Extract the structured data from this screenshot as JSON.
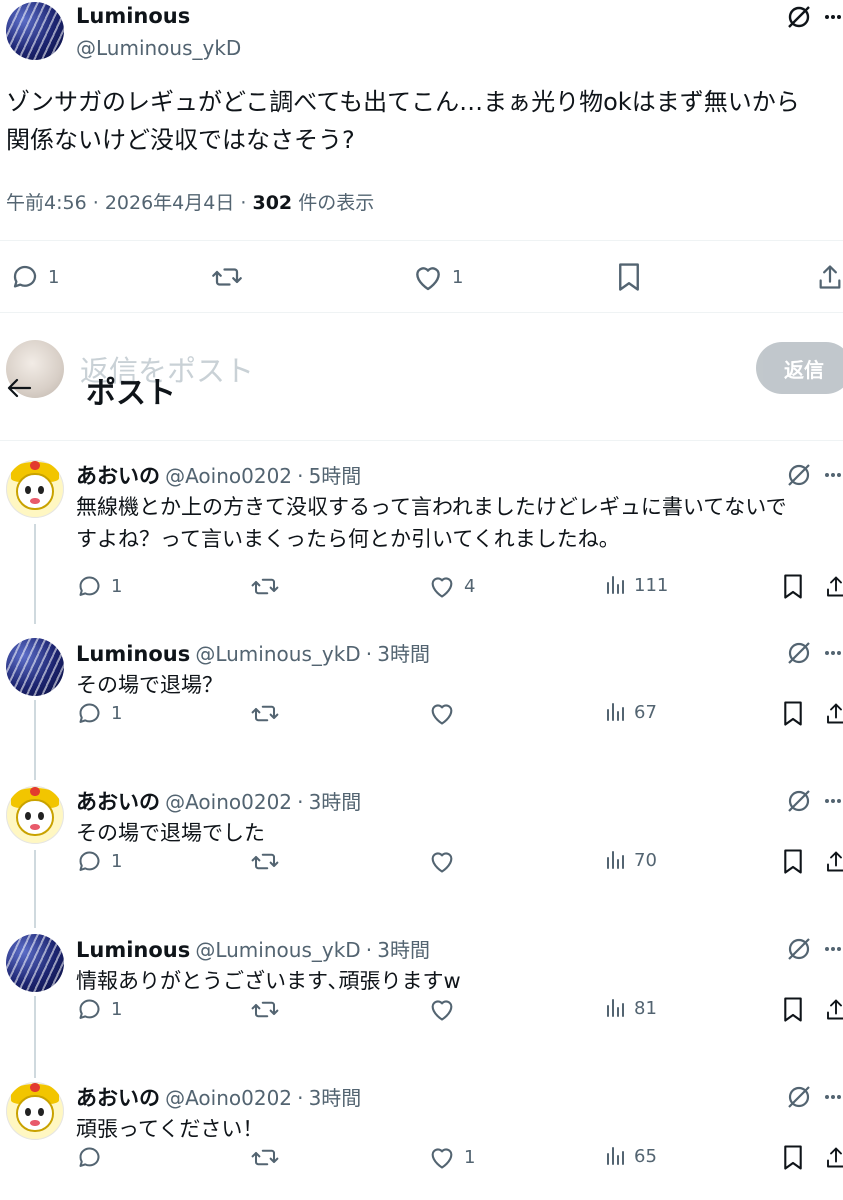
{
  "main_post": {
    "name": "Luminous",
    "handle": "@Luminous_ykD",
    "text_line1": "ゾンサガのレギュがどこ調べても出てこん…まぁ光り物okはまず無いから",
    "text_line2": "関係ないけど没収ではなさそう?",
    "time": "午前4:56",
    "date": "2026年4月4日",
    "views_count": "302",
    "views_label": "件の表示",
    "replies": "1",
    "likes": "1"
  },
  "compose": {
    "placeholder": "返信をポスト",
    "reply_label": "返信"
  },
  "header": {
    "title": "ポスト"
  },
  "replies": [
    {
      "name": "あおいの",
      "handle": "@Aoino0202",
      "time": "5時間",
      "line1": "無線機とか上の方きて没収するって言われましたけどレギュに書いてないで",
      "line2": "すよね？って言いまくったら何とか引いてくれましたね。",
      "replies": "1",
      "likes": "4",
      "views": "111"
    },
    {
      "name": "Luminous",
      "handle": "@Luminous_ykD",
      "time": "3時間",
      "line1": "その場で退場？",
      "replies": "1",
      "likes": "",
      "views": "67"
    },
    {
      "name": "あおいの",
      "handle": "@Aoino0202",
      "time": "3時間",
      "line1": "その場で退場でした",
      "replies": "1",
      "likes": "",
      "views": "70"
    },
    {
      "name": "Luminous",
      "handle": "@Luminous_ykD",
      "time": "3時間",
      "line1": "情報ありがとうございます､頑張りますw",
      "replies": "1",
      "likes": "",
      "views": "81"
    },
    {
      "name": "あおいの",
      "handle": "@Aoino0202",
      "time": "3時間",
      "line1": "頑張ってください！",
      "replies": "",
      "likes": "1",
      "views": "65"
    }
  ],
  "separator": "·",
  "icons": [
    "grok-icon",
    "more-icon",
    "reply-icon",
    "repost-icon",
    "like-icon",
    "bookmark-icon",
    "share-icon",
    "views-icon",
    "back-arrow-icon"
  ],
  "colors": {
    "text": "#0f1419",
    "secondary": "#536471",
    "divider": "#eff3f4",
    "thread": "#cfd9de"
  }
}
